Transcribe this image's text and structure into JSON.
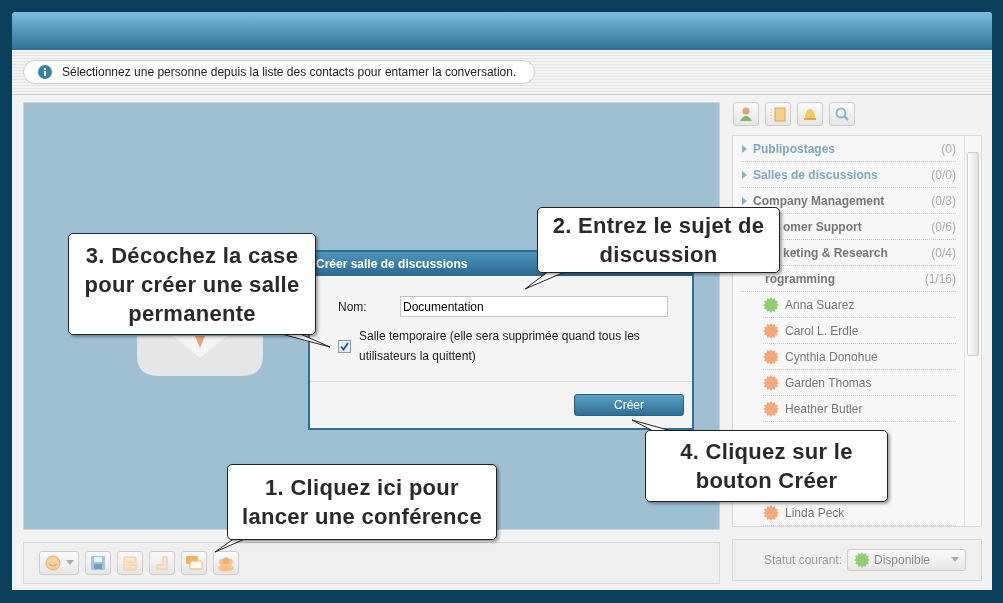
{
  "info_bar": {
    "message": "Sélectionnez une personne depuis la liste des contacts pour entamer la conversation."
  },
  "contacts": {
    "groups": [
      {
        "name": "Publipostages",
        "count": "(0)",
        "kind": "system",
        "expanded": false
      },
      {
        "name": "Salles de discussions",
        "count": "(0/0)",
        "kind": "system",
        "expanded": false
      },
      {
        "name": "Company Management",
        "count": "(0/3)",
        "kind": "team",
        "expanded": false
      },
      {
        "name": "omer Support",
        "count": "(0/6)",
        "kind": "team"
      },
      {
        "name": "keting & Research",
        "count": "(0/4)",
        "kind": "team"
      },
      {
        "name": "rogramming",
        "count": "(1/16)",
        "kind": "team",
        "children": [
          {
            "name": "Anna Suarez",
            "color": "#8fcf6f"
          },
          {
            "name": "Carol L. Erdle",
            "color": "#f5a87a"
          },
          {
            "name": "Cynthia Donohue",
            "color": "#f5a87a"
          },
          {
            "name": "Garden Thomas",
            "color": "#f5a87a"
          },
          {
            "name": "Heather Butler",
            "color": "#f5a87a"
          },
          {
            "name": "Linda Peck",
            "color": "#f5a87a"
          }
        ]
      }
    ]
  },
  "status": {
    "label": "Statut courant:",
    "value": "Disponible",
    "color": "#8fcf6f"
  },
  "dialog": {
    "title": "Créer salle de discussions",
    "name_label": "Nom:",
    "name_value": "Documentation",
    "temporary": {
      "label": "Salle temporaire (elle sera supprimée quand tous les utilisateurs la quittent)",
      "checked": true
    },
    "create_button": "Créer"
  },
  "callouts": [
    {
      "text": "1. Cliquez ici pour lancer une conférence"
    },
    {
      "text": "2. Entrez le sujet de discussion"
    },
    {
      "text": "3. Décochez la case pour créer une salle permanente"
    },
    {
      "text": "4. Cliquez sur le bouton Créer"
    }
  ]
}
